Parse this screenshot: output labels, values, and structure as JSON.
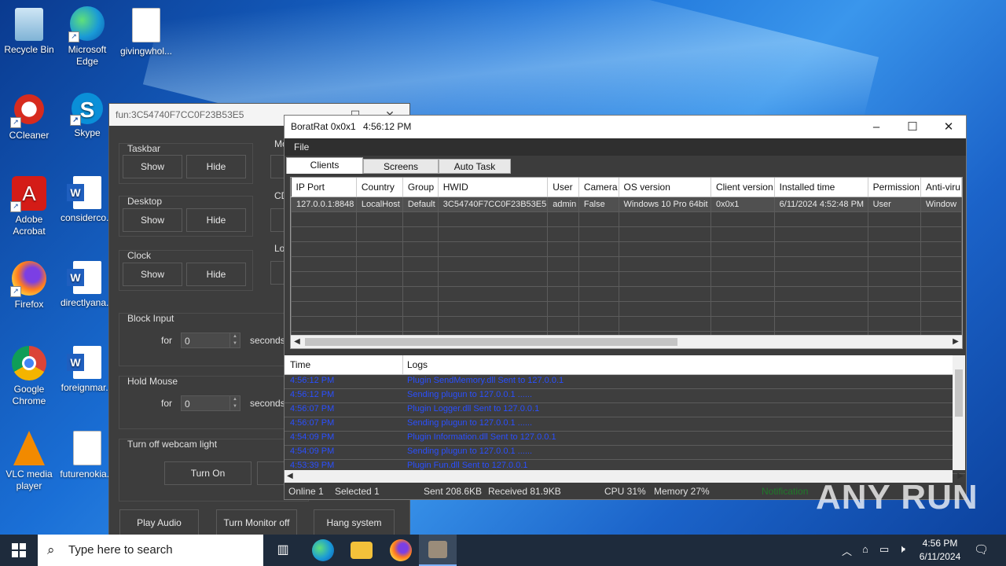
{
  "desktop": {
    "icons": [
      {
        "label": "Recycle Bin"
      },
      {
        "label": "Microsoft Edge"
      },
      {
        "label": "givingwhol..."
      },
      {
        "label": "CCleaner"
      },
      {
        "label": "Skype"
      },
      {
        "label": "Adobe Acrobat"
      },
      {
        "label": "considerco..."
      },
      {
        "label": "Firefox"
      },
      {
        "label": "directlyana..."
      },
      {
        "label": "Google Chrome"
      },
      {
        "label": "foreignmar..."
      },
      {
        "label": "VLC media player"
      },
      {
        "label": "futurenokia..."
      }
    ]
  },
  "fun_window": {
    "title": "fun:3C54740F7CC0F23B53E5",
    "taskbar_group": {
      "label": "Taskbar",
      "show": "Show",
      "hide": "Hide"
    },
    "desktop_group": {
      "label": "Desktop",
      "show": "Show",
      "hide": "Hide"
    },
    "clock_group": {
      "label": "Clock",
      "show": "Show",
      "hide": "Hide"
    },
    "partial_labels": {
      "mo": "Mo",
      "cd": "CD",
      "lo": "Lo"
    },
    "block_input": {
      "label": "Block Input",
      "for": "for",
      "value": "0",
      "unit": "seconds"
    },
    "hold_mouse": {
      "label": "Hold Mouse",
      "for": "for",
      "value": "0",
      "unit": "seconds"
    },
    "webcam": {
      "label": "Turn off webcam light",
      "turn_on": "Turn On"
    },
    "buttons": {
      "play_audio": "Play Audio",
      "turn_monitor_off": "Turn Monitor off",
      "hang_system": "Hang system"
    }
  },
  "borat_window": {
    "title": "BoratRat 0x0x1",
    "time": "4:56:12 PM",
    "menu": {
      "file": "File"
    },
    "tabs": [
      {
        "label": "Clients"
      },
      {
        "label": "Screens"
      },
      {
        "label": "Auto Task"
      }
    ],
    "clients_columns": [
      "IP Port",
      "Country",
      "Group",
      "HWID",
      "User",
      "Camera",
      "OS version",
      "Client version",
      "Installed time",
      "Permission",
      "Anti-viru"
    ],
    "clients_rows": [
      [
        "127.0.0.1:8848",
        "LocalHost",
        "Default",
        "3C54740F7CC0F23B53E5",
        "admin",
        "False",
        "Windows 10 Pro 64bit",
        "0x0x1",
        "6/11/2024 4:52:48 PM",
        "User",
        "Window"
      ]
    ],
    "logs_columns": {
      "time": "Time",
      "logs": "Logs"
    },
    "logs": [
      {
        "time": "4:56:12 PM",
        "msg": "Plugin SendMemory.dll Sent to 127.0.0.1"
      },
      {
        "time": "4:56:12 PM",
        "msg": "Sending plugun to 127.0.0.1 ......"
      },
      {
        "time": "4:56:07 PM",
        "msg": "Plugin Logger.dll Sent to 127.0.0.1"
      },
      {
        "time": "4:56:07 PM",
        "msg": "Sending plugun to 127.0.0.1 ......"
      },
      {
        "time": "4:54:09 PM",
        "msg": "Plugin Information.dll Sent to 127.0.0.1"
      },
      {
        "time": "4:54:09 PM",
        "msg": "Sending plugun to 127.0.0.1 ......"
      },
      {
        "time": "4:53:39 PM",
        "msg": "Plugin Fun.dll Sent to 127.0.0.1"
      }
    ],
    "status": {
      "online": "Online 1",
      "selected": "Selected 1",
      "sent": "Sent 208.6KB",
      "received": "Received  81.9KB",
      "cpu": "CPU 31%",
      "memory": "Memory 27%",
      "notification": "Notification"
    }
  },
  "taskbar": {
    "search_placeholder": "Type here to search",
    "clock_time": "4:56 PM",
    "clock_date": "6/11/2024"
  },
  "watermark": "ANY RUN",
  "colors": {
    "accent": "#1a6fd6",
    "log_text": "#2a4fff",
    "window_dark": "#3c3c3c"
  }
}
